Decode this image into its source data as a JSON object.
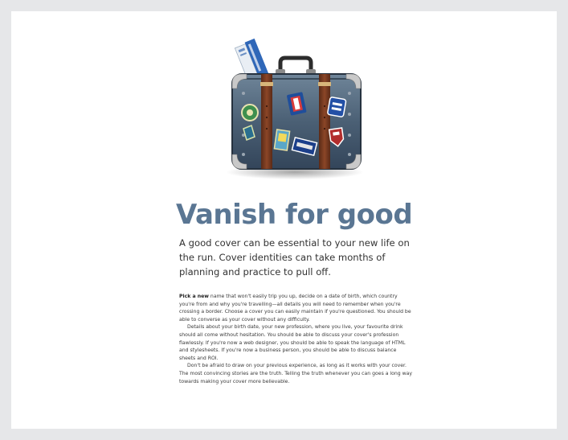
{
  "article": {
    "headline": "Vanish for good",
    "lede": "A good cover can be essential to your new life on the run. Cover identities can take months of planning and practice to pull off.",
    "paragraphs": [
      {
        "lead": "Pick a new",
        "text": " name that won't easily trip you up, decide on a date of birth, which country you're from and why you're travelling—all details you will need to remember when you're crossing a border. Choose a cover you can easily maintain if you're questioned. You should be able to converse as your cover without any difficulty."
      },
      {
        "text": "Details about your birth date, your new profession, where you live, your favourite drink should all come without hesitation. You should be able to discuss your cover's profession flawlessly. If you're now a web designer, you should be able to speak the language of HTML and stylesheets. If you're now a business person, you should be able to discuss balance sheets and ROI."
      },
      {
        "text": "Don't be afraid to draw on your previous experience, as long as it works with your cover. The most convincing stories are the truth. Telling the truth whenever you can goes a long way towards making your cover more believable."
      }
    ]
  },
  "illustration": {
    "icon": "suitcase-icon",
    "case_color": "#4b6075",
    "strap_color": "#7a3a22",
    "ticket_color": "#2f67b8"
  },
  "colors": {
    "headline": "#5a7693",
    "page_bg": "#e6e7e9"
  }
}
